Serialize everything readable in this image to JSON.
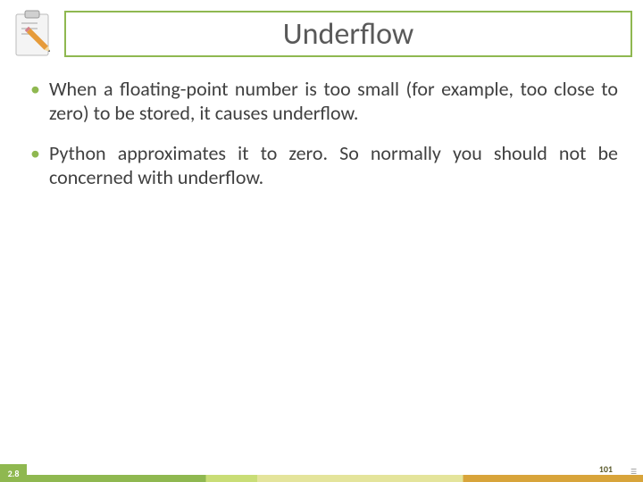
{
  "title": "Underflow",
  "bullets": [
    "When a floating-point number is too small (for example, too close to zero) to be stored, it causes underflow.",
    "Python approximates it to zero. So normally you should not be concerned with underflow."
  ],
  "section_number": "2.8",
  "page_number": "101",
  "colors": {
    "accent_green": "#8fb850",
    "text_gray": "#595959"
  }
}
